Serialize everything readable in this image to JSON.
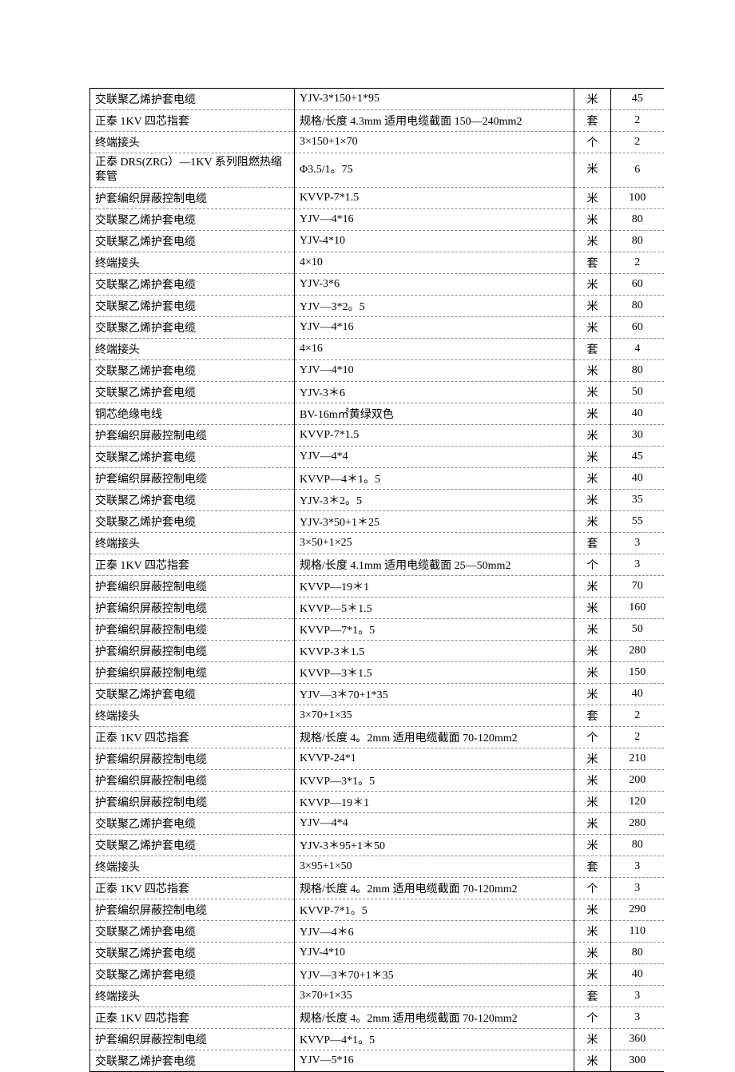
{
  "rows": [
    {
      "name": "交联聚乙烯护套电缆",
      "spec": "YJV-3*150+1*95",
      "unit": "米",
      "qty": "45"
    },
    {
      "name": "正泰 1KV 四芯指套",
      "spec": "规格/长度 4.3mm 适用电缆截面 150—240mm2",
      "unit": "套",
      "qty": "2"
    },
    {
      "name": "终端接头",
      "spec": "3×150+1×70",
      "unit": "个",
      "qty": "2"
    },
    {
      "name": "正泰 DRS(ZRG）—1KV 系列阻燃热缩套管",
      "spec": "Φ3.5/1。75",
      "unit": "米",
      "qty": "6",
      "tall": true
    },
    {
      "name": "护套编织屏蔽控制电缆",
      "spec": "KVVP-7*1.5",
      "unit": "米",
      "qty": "100"
    },
    {
      "name": "交联聚乙烯护套电缆",
      "spec": "YJV—4*16",
      "unit": "米",
      "qty": "80"
    },
    {
      "name": "交联聚乙烯护套电缆",
      "spec": "YJV-4*10",
      "unit": "米",
      "qty": "80"
    },
    {
      "name": "终端接头",
      "spec": "4×10",
      "unit": "套",
      "qty": "2"
    },
    {
      "name": "交联聚乙烯护套电缆",
      "spec": "YJV-3*6",
      "unit": "米",
      "qty": "60"
    },
    {
      "name": "交联聚乙烯护套电缆",
      "spec": "YJV—3*2。5",
      "unit": "米",
      "qty": "80"
    },
    {
      "name": "交联聚乙烯护套电缆",
      "spec": "YJV—4*16",
      "unit": "米",
      "qty": "60"
    },
    {
      "name": "终端接头",
      "spec": "4×16",
      "unit": "套",
      "qty": "4"
    },
    {
      "name": "交联聚乙烯护套电缆",
      "spec": "YJV—4*10",
      "unit": "米",
      "qty": "80"
    },
    {
      "name": "交联聚乙烯护套电缆",
      "spec": "YJV-3＊6",
      "unit": "米",
      "qty": "50"
    },
    {
      "name": "铜芯绝缘电线",
      "spec": "BV-16m㎡黄绿双色",
      "unit": "米",
      "qty": "40"
    },
    {
      "name": "护套编织屏蔽控制电缆",
      "spec": "KVVP-7*1.5",
      "unit": "米",
      "qty": "30"
    },
    {
      "name": "交联聚乙烯护套电缆",
      "spec": "YJV—4*4",
      "unit": "米",
      "qty": "45"
    },
    {
      "name": "护套编织屏蔽控制电缆",
      "spec": "KVVP—4＊1。5",
      "unit": "米",
      "qty": "40"
    },
    {
      "name": "交联聚乙烯护套电缆",
      "spec": "YJV-3＊2。5",
      "unit": "米",
      "qty": "35"
    },
    {
      "name": "交联聚乙烯护套电缆",
      "spec": "YJV-3*50+1＊25",
      "unit": "米",
      "qty": "55"
    },
    {
      "name": "终端接头",
      "spec": "3×50+1×25",
      "unit": "套",
      "qty": "3"
    },
    {
      "name": "正泰 1KV 四芯指套",
      "spec": "规格/长度 4.1mm 适用电缆截面 25—50mm2",
      "unit": "个",
      "qty": "3"
    },
    {
      "name": "护套编织屏蔽控制电缆",
      "spec": "KVVP—19＊1",
      "unit": "米",
      "qty": "70"
    },
    {
      "name": "护套编织屏蔽控制电缆",
      "spec": "KVVP—5＊1.5",
      "unit": "米",
      "qty": "160"
    },
    {
      "name": "护套编织屏蔽控制电缆",
      "spec": "KVVP—7*1。5",
      "unit": "米",
      "qty": "50"
    },
    {
      "name": "护套编织屏蔽控制电缆",
      "spec": "KVVP-3＊1.5",
      "unit": "米",
      "qty": "280"
    },
    {
      "name": "护套编织屏蔽控制电缆",
      "spec": "KVVP—3＊1.5",
      "unit": "米",
      "qty": "150"
    },
    {
      "name": "交联聚乙烯护套电缆",
      "spec": "YJV—3＊70+1*35",
      "unit": "米",
      "qty": "40"
    },
    {
      "name": "终端接头",
      "spec": "3×70+1×35",
      "unit": "套",
      "qty": "2"
    },
    {
      "name": "正泰 1KV 四芯指套",
      "spec": "规格/长度 4。2mm 适用电缆截面 70-120mm2",
      "unit": "个",
      "qty": "2"
    },
    {
      "name": "护套编织屏蔽控制电缆",
      "spec": "KVVP-24*1",
      "unit": "米",
      "qty": "210"
    },
    {
      "name": "护套编织屏蔽控制电缆",
      "spec": "KVVP—3*1。5",
      "unit": "米",
      "qty": "200"
    },
    {
      "name": "护套编织屏蔽控制电缆",
      "spec": "KVVP—19＊1",
      "unit": "米",
      "qty": "120"
    },
    {
      "name": "交联聚乙烯护套电缆",
      "spec": "YJV—4*4",
      "unit": "米",
      "qty": "280"
    },
    {
      "name": "交联聚乙烯护套电缆",
      "spec": "YJV-3＊95+1＊50",
      "unit": "米",
      "qty": "80"
    },
    {
      "name": "终端接头",
      "spec": "3×95+1×50",
      "unit": "套",
      "qty": "3"
    },
    {
      "name": "正泰 1KV 四芯指套",
      "spec": "规格/长度 4。2mm 适用电缆截面 70-120mm2",
      "unit": "个",
      "qty": "3"
    },
    {
      "name": "护套编织屏蔽控制电缆",
      "spec": "KVVP-7*1。5",
      "unit": "米",
      "qty": "290"
    },
    {
      "name": "交联聚乙烯护套电缆",
      "spec": "YJV—4＊6",
      "unit": "米",
      "qty": "110"
    },
    {
      "name": "交联聚乙烯护套电缆",
      "spec": "YJV-4*10",
      "unit": "米",
      "qty": "80"
    },
    {
      "name": "交联聚乙烯护套电缆",
      "spec": "YJV—3＊70+1＊35",
      "unit": "米",
      "qty": "40"
    },
    {
      "name": "终端接头",
      "spec": "3×70+1×35",
      "unit": "套",
      "qty": "3"
    },
    {
      "name": "正泰 1KV 四芯指套",
      "spec": "规格/长度 4。2mm 适用电缆截面 70-120mm2",
      "unit": "个",
      "qty": "3"
    },
    {
      "name": "护套编织屏蔽控制电缆",
      "spec": "KVVP—4*1。5",
      "unit": "米",
      "qty": "360"
    },
    {
      "name": "交联聚乙烯护套电缆",
      "spec": "YJV—5*16",
      "unit": "米",
      "qty": "300"
    }
  ]
}
